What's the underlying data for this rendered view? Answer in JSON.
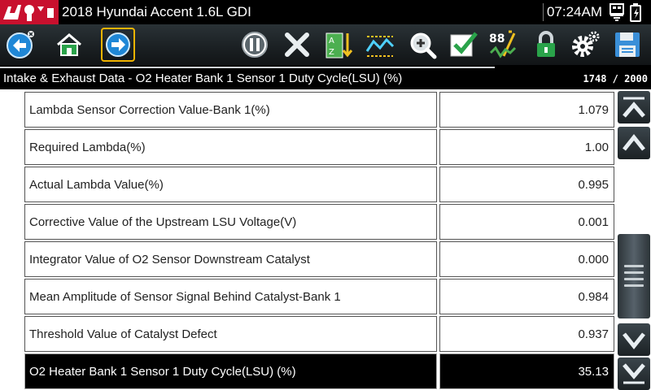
{
  "title_bar": {
    "vehicle": "2018 Hyundai Accent 1.6L GDI",
    "time": "07:24AM"
  },
  "toolbar": {
    "buttons": [
      {
        "name": "back",
        "icon": "back-arrow-icon"
      },
      {
        "name": "home",
        "icon": "home-icon"
      },
      {
        "name": "forward",
        "icon": "forward-arrow-icon",
        "highlighted": true
      },
      {
        "name": "pause",
        "icon": "pause-icon"
      },
      {
        "name": "clear",
        "icon": "x-icon"
      },
      {
        "name": "sort",
        "icon": "sort-az-icon"
      },
      {
        "name": "graph",
        "icon": "graph-icon"
      },
      {
        "name": "zoom",
        "icon": "zoom-icon"
      },
      {
        "name": "select",
        "icon": "checkmark-icon"
      },
      {
        "name": "units",
        "icon": "units-88-icon"
      },
      {
        "name": "lock",
        "icon": "lock-icon"
      },
      {
        "name": "settings",
        "icon": "gear-icon"
      },
      {
        "name": "save",
        "icon": "floppy-disk-icon"
      }
    ]
  },
  "breadcrumb": {
    "text": "Intake & Exhaust Data - O2 Heater Bank 1 Sensor 1 Duty Cycle(LSU) (%)",
    "count": "1748 / 2000"
  },
  "rows": [
    {
      "name": "Lambda Sensor Correction Value-Bank 1(%)",
      "value": "1.079"
    },
    {
      "name": "Required Lambda(%)",
      "value": "1.00"
    },
    {
      "name": "Actual Lambda Value(%)",
      "value": "0.995"
    },
    {
      "name": "Corrective Value of the Upstream LSU Voltage(V)",
      "value": "0.001"
    },
    {
      "name": "Integrator Value of O2 Sensor Downstream Catalyst",
      "value": "0.000"
    },
    {
      "name": "Mean Amplitude of Sensor Signal Behind Catalyst-Bank 1",
      "value": "0.984"
    },
    {
      "name": "Threshold Value of Catalyst Defect",
      "value": "0.937"
    },
    {
      "name": "O2 Heater Bank 1 Sensor 1 Duty Cycle(LSU) (%)",
      "value": "35.13",
      "selected": true
    }
  ],
  "colors": {
    "brand_red": "#c8102e",
    "selection_border": "#f0b400",
    "selected_row_bg": "#000000"
  }
}
